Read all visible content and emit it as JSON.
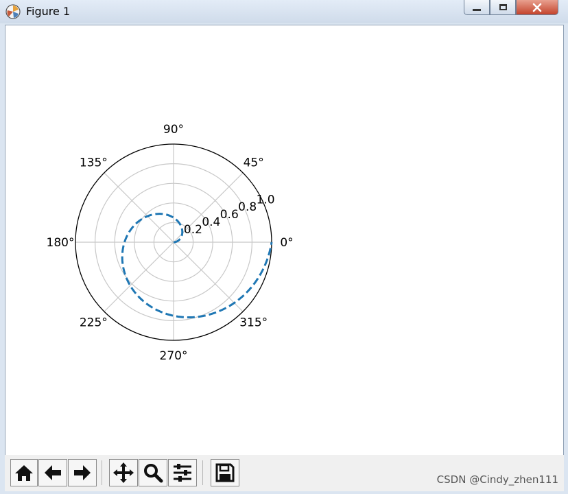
{
  "window": {
    "title": "Figure 1"
  },
  "toolbar": {
    "buttons": [
      {
        "name": "home",
        "icon": "home-icon"
      },
      {
        "name": "back",
        "icon": "arrow-left-icon"
      },
      {
        "name": "forward",
        "icon": "arrow-right-icon"
      },
      {
        "name": "pan",
        "icon": "move-icon"
      },
      {
        "name": "zoom",
        "icon": "magnifier-icon"
      },
      {
        "name": "configure-subplots",
        "icon": "sliders-icon"
      },
      {
        "name": "save",
        "icon": "floppy-disk-icon"
      }
    ]
  },
  "watermark": "CSDN @Cindy_zhen111",
  "chart_data": {
    "type": "line",
    "projection": "polar",
    "theta_tick_labels": [
      "0°",
      "45°",
      "90°",
      "135°",
      "180°",
      "225°",
      "270°",
      "315°"
    ],
    "r_tick_labels": [
      "0.2",
      "0.4",
      "0.6",
      "0.8",
      "1.0"
    ],
    "r_ticks": [
      0.2,
      0.4,
      0.6,
      0.8,
      1.0
    ],
    "rlim": [
      0,
      1.0
    ],
    "grid": true,
    "series": [
      {
        "line_style": "dashed",
        "color": "#1f77b4",
        "theta_deg": [
          0,
          30,
          60,
          90,
          120,
          150,
          180,
          210,
          240,
          270,
          300,
          330,
          360
        ],
        "r": [
          0.0,
          0.083,
          0.167,
          0.25,
          0.333,
          0.417,
          0.5,
          0.583,
          0.667,
          0.75,
          0.833,
          0.917,
          1.0
        ]
      }
    ]
  }
}
